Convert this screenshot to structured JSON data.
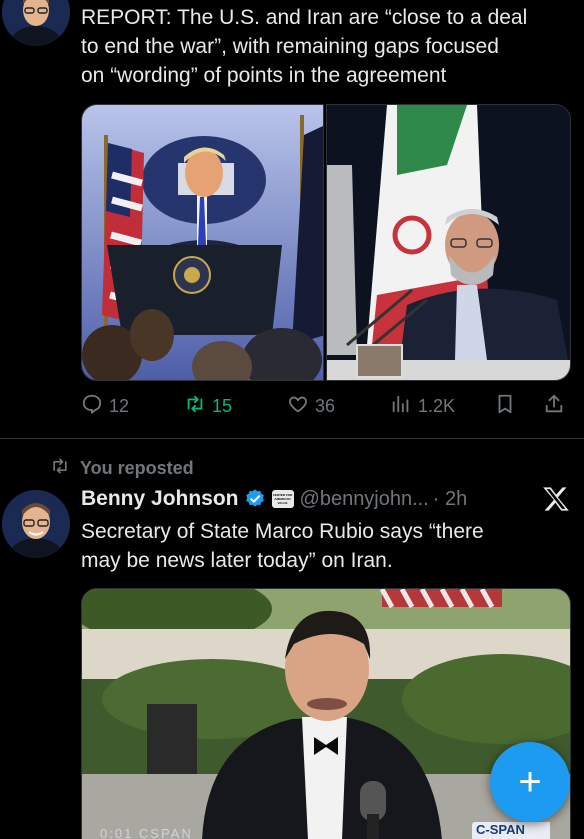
{
  "tweet1": {
    "text_line1": "REPORT: The U.S. and Iran are “close to a deal",
    "text_line2": "to end the war”, with remaining gaps focused",
    "text_line3": "on “wording” of points in the agreement",
    "actions": {
      "replies": "12",
      "reposts": "15",
      "likes": "36",
      "views": "1.2K"
    }
  },
  "repost_label": "You reposted",
  "tweet2": {
    "author_name": "Benny Johnson",
    "handle": "@bennyjohn...",
    "time": "· 2h",
    "affiliate_badge": "CENTER FOR AMERICAN VALUE",
    "text_line1": "Secretary of State Marco Rubio says “there",
    "text_line2": "may be news later today” on Iran.",
    "video_overlay_logo": "C-SPAN",
    "bottom_caption": "0:01 CSPAN"
  },
  "colors": {
    "background": "#000000",
    "text": "#e7e9ea",
    "muted": "#71767b",
    "repost_green": "#00ba7c",
    "accent_blue": "#1d9bf0"
  },
  "icons": [
    "reply-icon",
    "repost-icon",
    "like-icon",
    "views-icon",
    "bookmark-icon",
    "share-icon",
    "verified-icon",
    "x-logo-icon",
    "compose-icon"
  ]
}
